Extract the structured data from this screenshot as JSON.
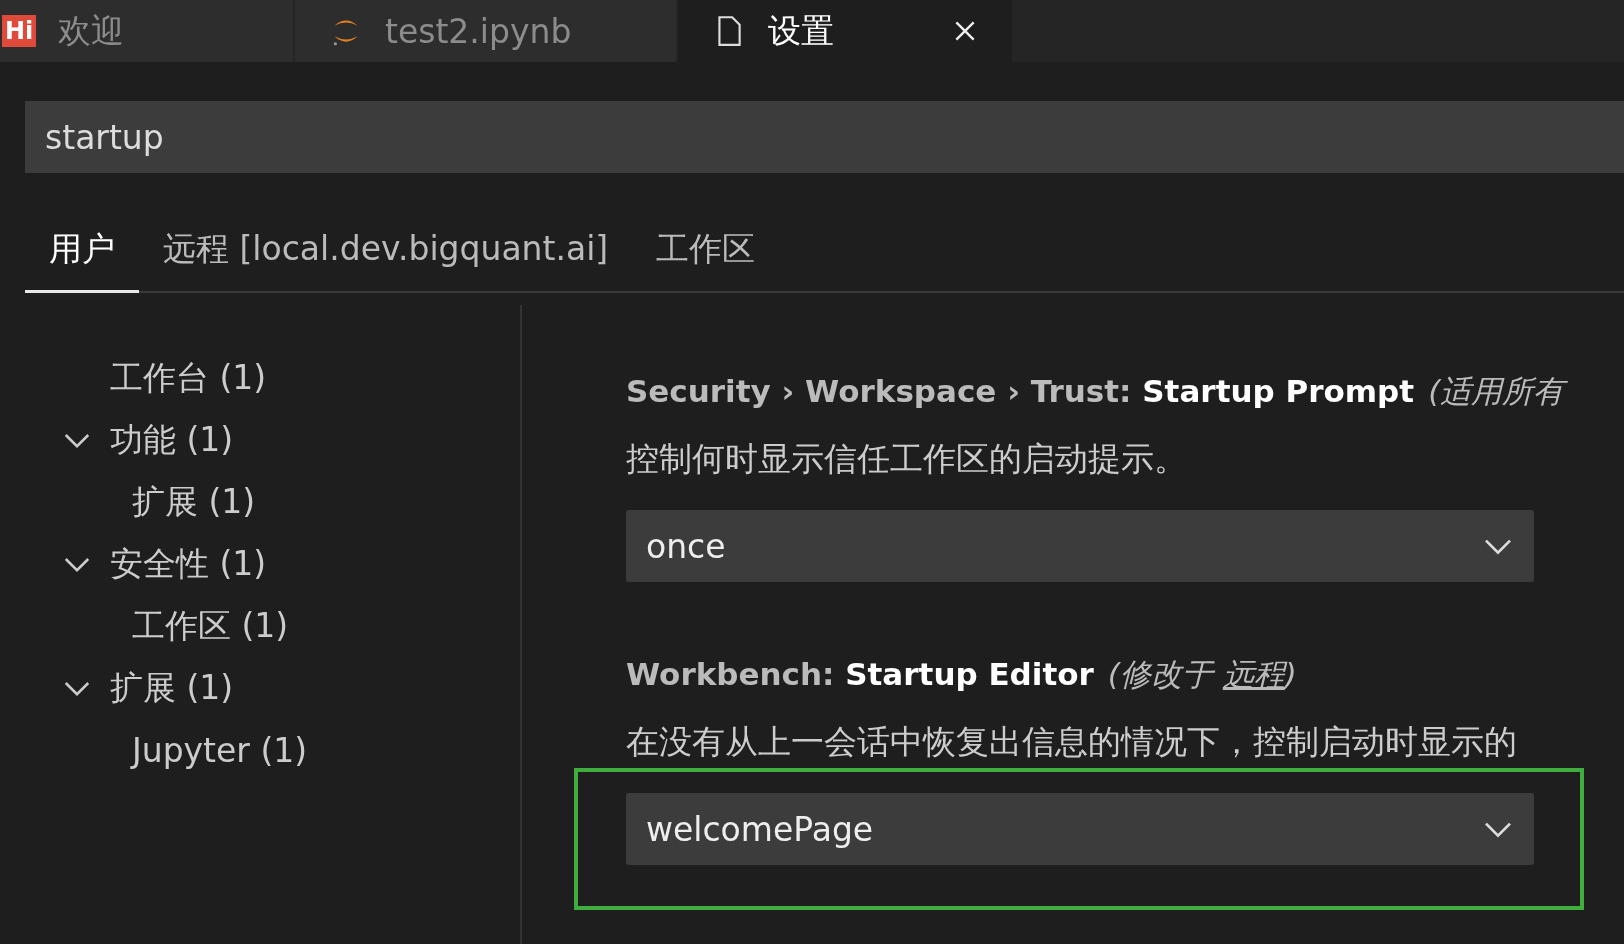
{
  "tabs": [
    {
      "label": "欢迎",
      "kind": "hi",
      "selected": false,
      "badge": "Hi"
    },
    {
      "label": "test2.ipynb",
      "kind": "jupyter",
      "selected": false
    },
    {
      "label": "设置",
      "kind": "file",
      "selected": true
    }
  ],
  "search": {
    "value": "startup"
  },
  "scopes": [
    {
      "label": "用户",
      "selected": true
    },
    {
      "label": "远程 [local.dev.bigquant.ai]",
      "selected": false
    },
    {
      "label": "工作区",
      "selected": false
    }
  ],
  "tree": [
    {
      "label": "工作台 (1)"
    },
    {
      "label": "功能 (1)",
      "expanded": true,
      "children": [
        {
          "label": "扩展 (1)"
        }
      ]
    },
    {
      "label": "安全性 (1)",
      "expanded": true,
      "children": [
        {
          "label": "工作区 (1)"
        }
      ]
    },
    {
      "label": "扩展 (1)",
      "expanded": true,
      "children": [
        {
          "label": "Jupyter (1)"
        }
      ]
    }
  ],
  "settings": [
    {
      "category": "Security › Workspace › Trust: ",
      "name": "Startup Prompt",
      "note_before": "(适用所有",
      "description": "控制何时显示信任工作区的启动提示。",
      "value": "once"
    },
    {
      "category": "Workbench: ",
      "name": "Startup Editor",
      "note_before": "(修改于 ",
      "note_link": "远程",
      "note_after": ")",
      "description": "在没有从上一会话中恢复出信息的情况下，控制启动时显示的",
      "value": "welcomePage",
      "highlighted": true
    }
  ]
}
